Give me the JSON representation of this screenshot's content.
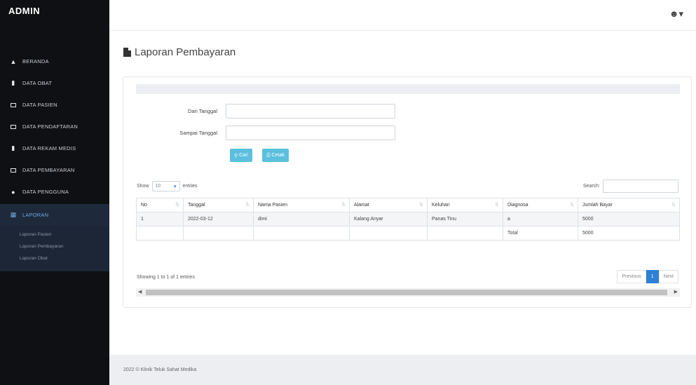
{
  "brand": "ADMIN",
  "sidebar": {
    "items": [
      {
        "label": "BERANDA",
        "icon": "home-icon"
      },
      {
        "label": "DATA OBAT",
        "icon": "pill-icon"
      },
      {
        "label": "DATA PASIEN",
        "icon": "box-icon"
      },
      {
        "label": "DATA PENDAFTARAN",
        "icon": "box-icon"
      },
      {
        "label": "DATA REKAM MEDIS",
        "icon": "book-icon"
      },
      {
        "label": "DATA PEMBAYARAN",
        "icon": "box-icon"
      },
      {
        "label": "DATA PENGGUNA",
        "icon": "user-icon"
      },
      {
        "label": "LAPORAN",
        "icon": "grid-icon"
      }
    ],
    "subitems": [
      "Laporan Pasien",
      "Laporan Pembayaran",
      "Laporan Obat"
    ]
  },
  "page": {
    "title": "Laporan Pembayaran"
  },
  "form": {
    "from_label": "Dari Tanggal",
    "to_label": "Sampai Tanggal",
    "search_btn": "Cari",
    "print_btn": "Cetak"
  },
  "datatable": {
    "show_label": "Show",
    "entries_label": "entries",
    "length_value": "10",
    "search_label": "Search:",
    "columns": [
      "No",
      "Tanggal",
      "Nama Pasien",
      "Alamat",
      "Keluhan",
      "Diagnosa",
      "Jumlah Bayar"
    ],
    "row": {
      "no": "1",
      "tanggal": "2022-03-12",
      "nama": "dimi",
      "alamat": "Kalang Anyar",
      "keluhan": "Panas Tinu",
      "diagnosa": "a",
      "jumlah": "5000"
    },
    "total_label": "Total",
    "total_value": "5000",
    "info": "Showing 1 to 1 of 1 entries",
    "prev": "Previous",
    "page": "1",
    "next": "Next"
  },
  "footer": "2022 © Klinik Teluk Sahat Medika"
}
